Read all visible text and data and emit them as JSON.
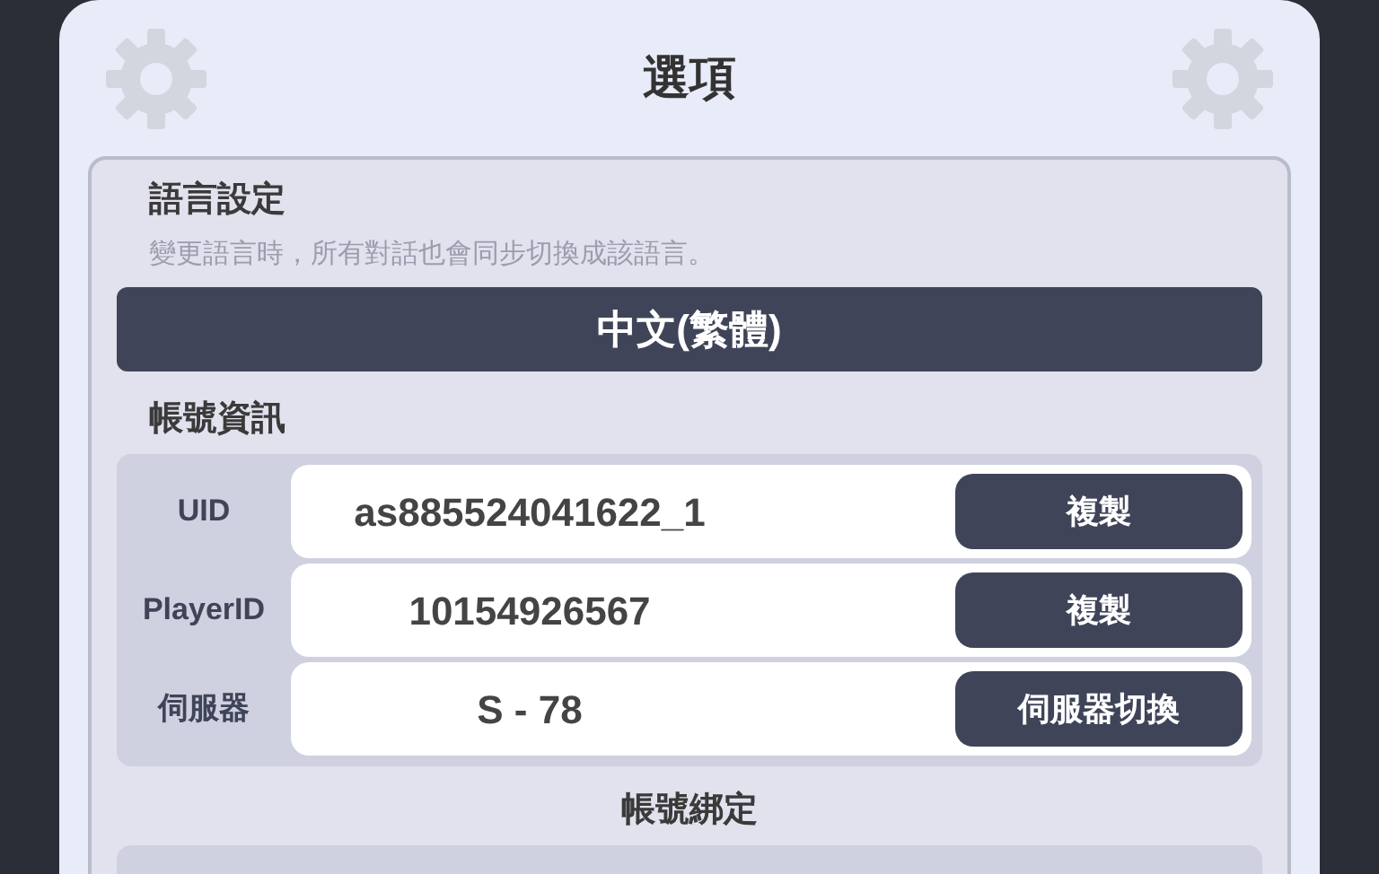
{
  "dialog": {
    "title": "選項"
  },
  "language": {
    "heading": "語言設定",
    "description": "變更語言時，所有對話也會同步切換成該語言。",
    "current": "中文(繁體)"
  },
  "account": {
    "heading": "帳號資訊",
    "rows": [
      {
        "label": "UID",
        "value": "as885524041622_1",
        "button": "複製"
      },
      {
        "label": "PlayerID",
        "value": "10154926567",
        "button": "複製"
      },
      {
        "label": "伺服器",
        "value": "S - 78",
        "button": "伺服器切換"
      }
    ]
  },
  "binding": {
    "heading": "帳號綁定"
  }
}
